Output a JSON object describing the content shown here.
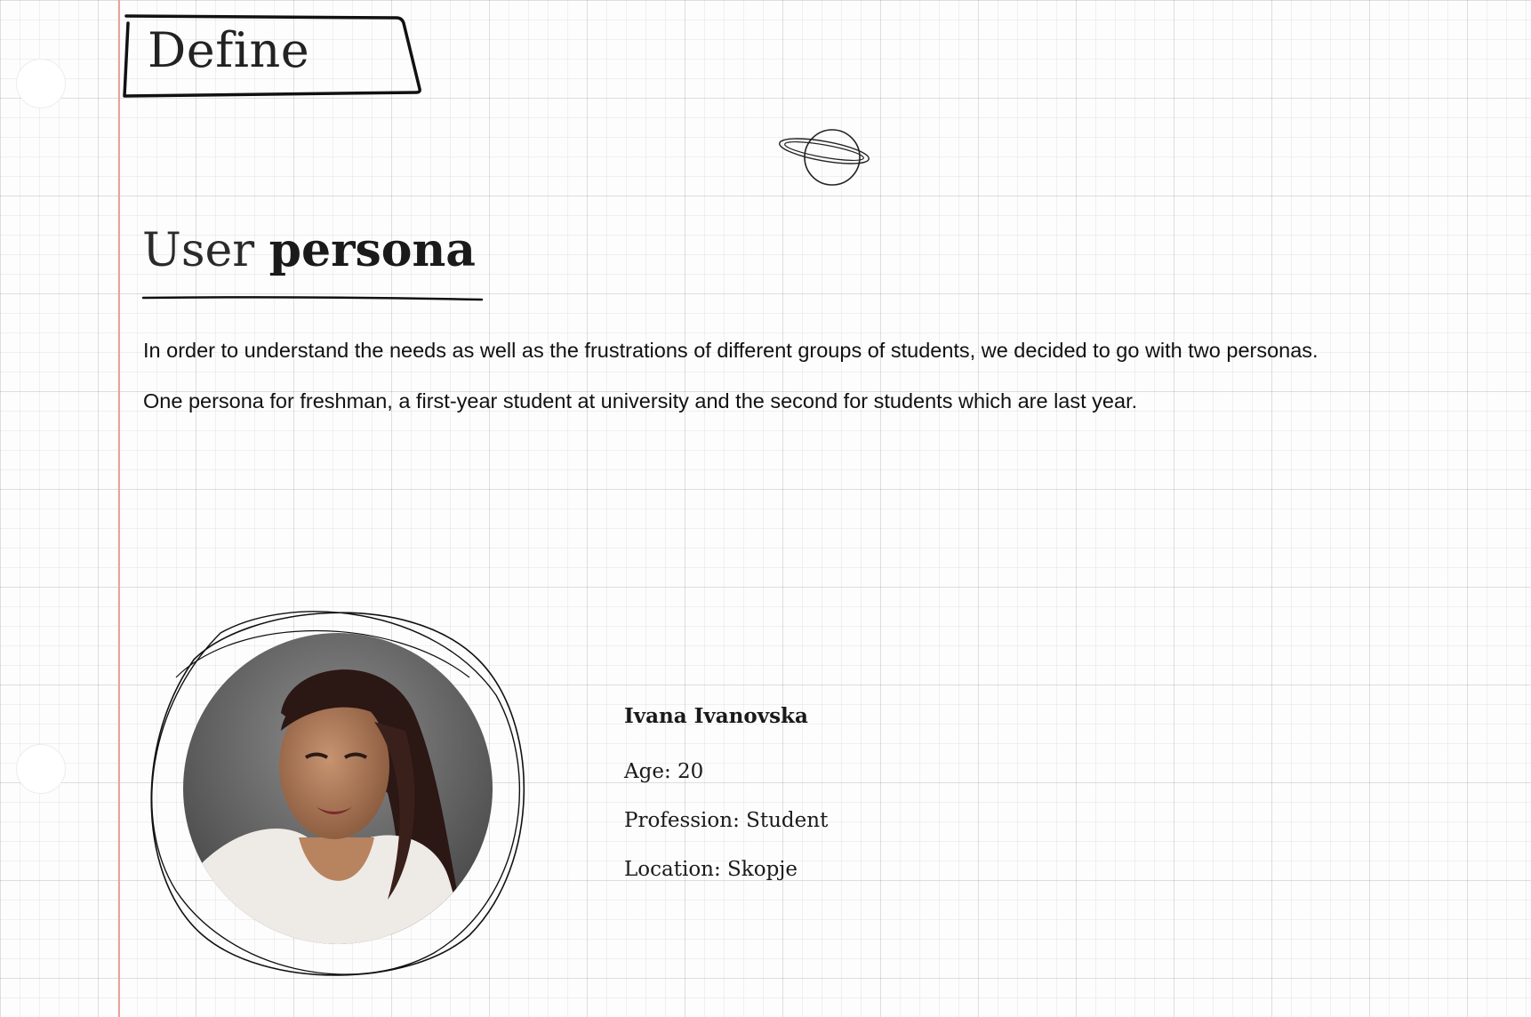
{
  "section": {
    "label": "Define"
  },
  "persona_section": {
    "heading_light": "User",
    "heading_bold": "persona",
    "paragraphs": [
      "In order to understand the needs as well as the frustrations of different groups of students, we decided to go with two personas.",
      "One persona for freshman, a first-year student at university and the second for students which are last year."
    ]
  },
  "persona": {
    "name": "Ivana Ivanovska",
    "age": "Age: 20",
    "profession": "Profession: Student",
    "location": "Location: Skopje"
  },
  "decor": {
    "planet_icon": "planet-icon",
    "margin_color": "#e8a49c",
    "grid_color": "#e6e6e6"
  }
}
